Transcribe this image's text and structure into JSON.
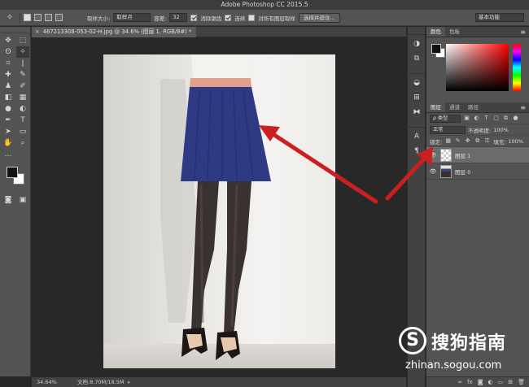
{
  "app": {
    "title": "Adobe Photoshop CC 2015.5"
  },
  "options": {
    "sample_size_label": "取样大小:",
    "sample_size_value": "取样点",
    "tolerance_label": "容差:",
    "tolerance_value": "32",
    "antialias_label": "消除锯齿",
    "contiguous_label": "连续",
    "sample_all_label": "对所有图层取样",
    "select_mask_button": "选择并遮住...",
    "workspace": "基本功能"
  },
  "document": {
    "tab_label": "467213308-053-02-H.jpg @ 34.6% (图层 1, RGB/8#) *",
    "close_glyph": "×"
  },
  "status": {
    "zoom": "34.64%",
    "doc_size": "文档:8.70M/18.5M",
    "arrow": "▸"
  },
  "color_panel": {
    "tabs": [
      "颜色",
      "色板"
    ]
  },
  "layers_panel": {
    "tabs": [
      "图层",
      "通道",
      "路径"
    ],
    "filter_kind": "ρ 类型",
    "blend_mode": "正常",
    "opacity_label": "不透明度:",
    "opacity_value": "100%",
    "lock_label": "锁定:",
    "fill_label": "填充:",
    "fill_value": "100%",
    "layers": [
      {
        "name": "图层 1",
        "selected": true
      },
      {
        "name": "图层 0",
        "selected": false
      }
    ],
    "footer_icons": [
      "link-icon",
      "fx-icon",
      "mask-icon",
      "adjustment-icon",
      "folder-icon",
      "new-layer-icon",
      "trash-icon"
    ]
  },
  "watermark": {
    "logo": "S",
    "name": "搜狗指南",
    "url": "zhinan.sogou.com"
  },
  "colors": {
    "arrow": "#cc1f1f",
    "skirt": "#2e3a84",
    "waistband": "#e1a08c"
  }
}
